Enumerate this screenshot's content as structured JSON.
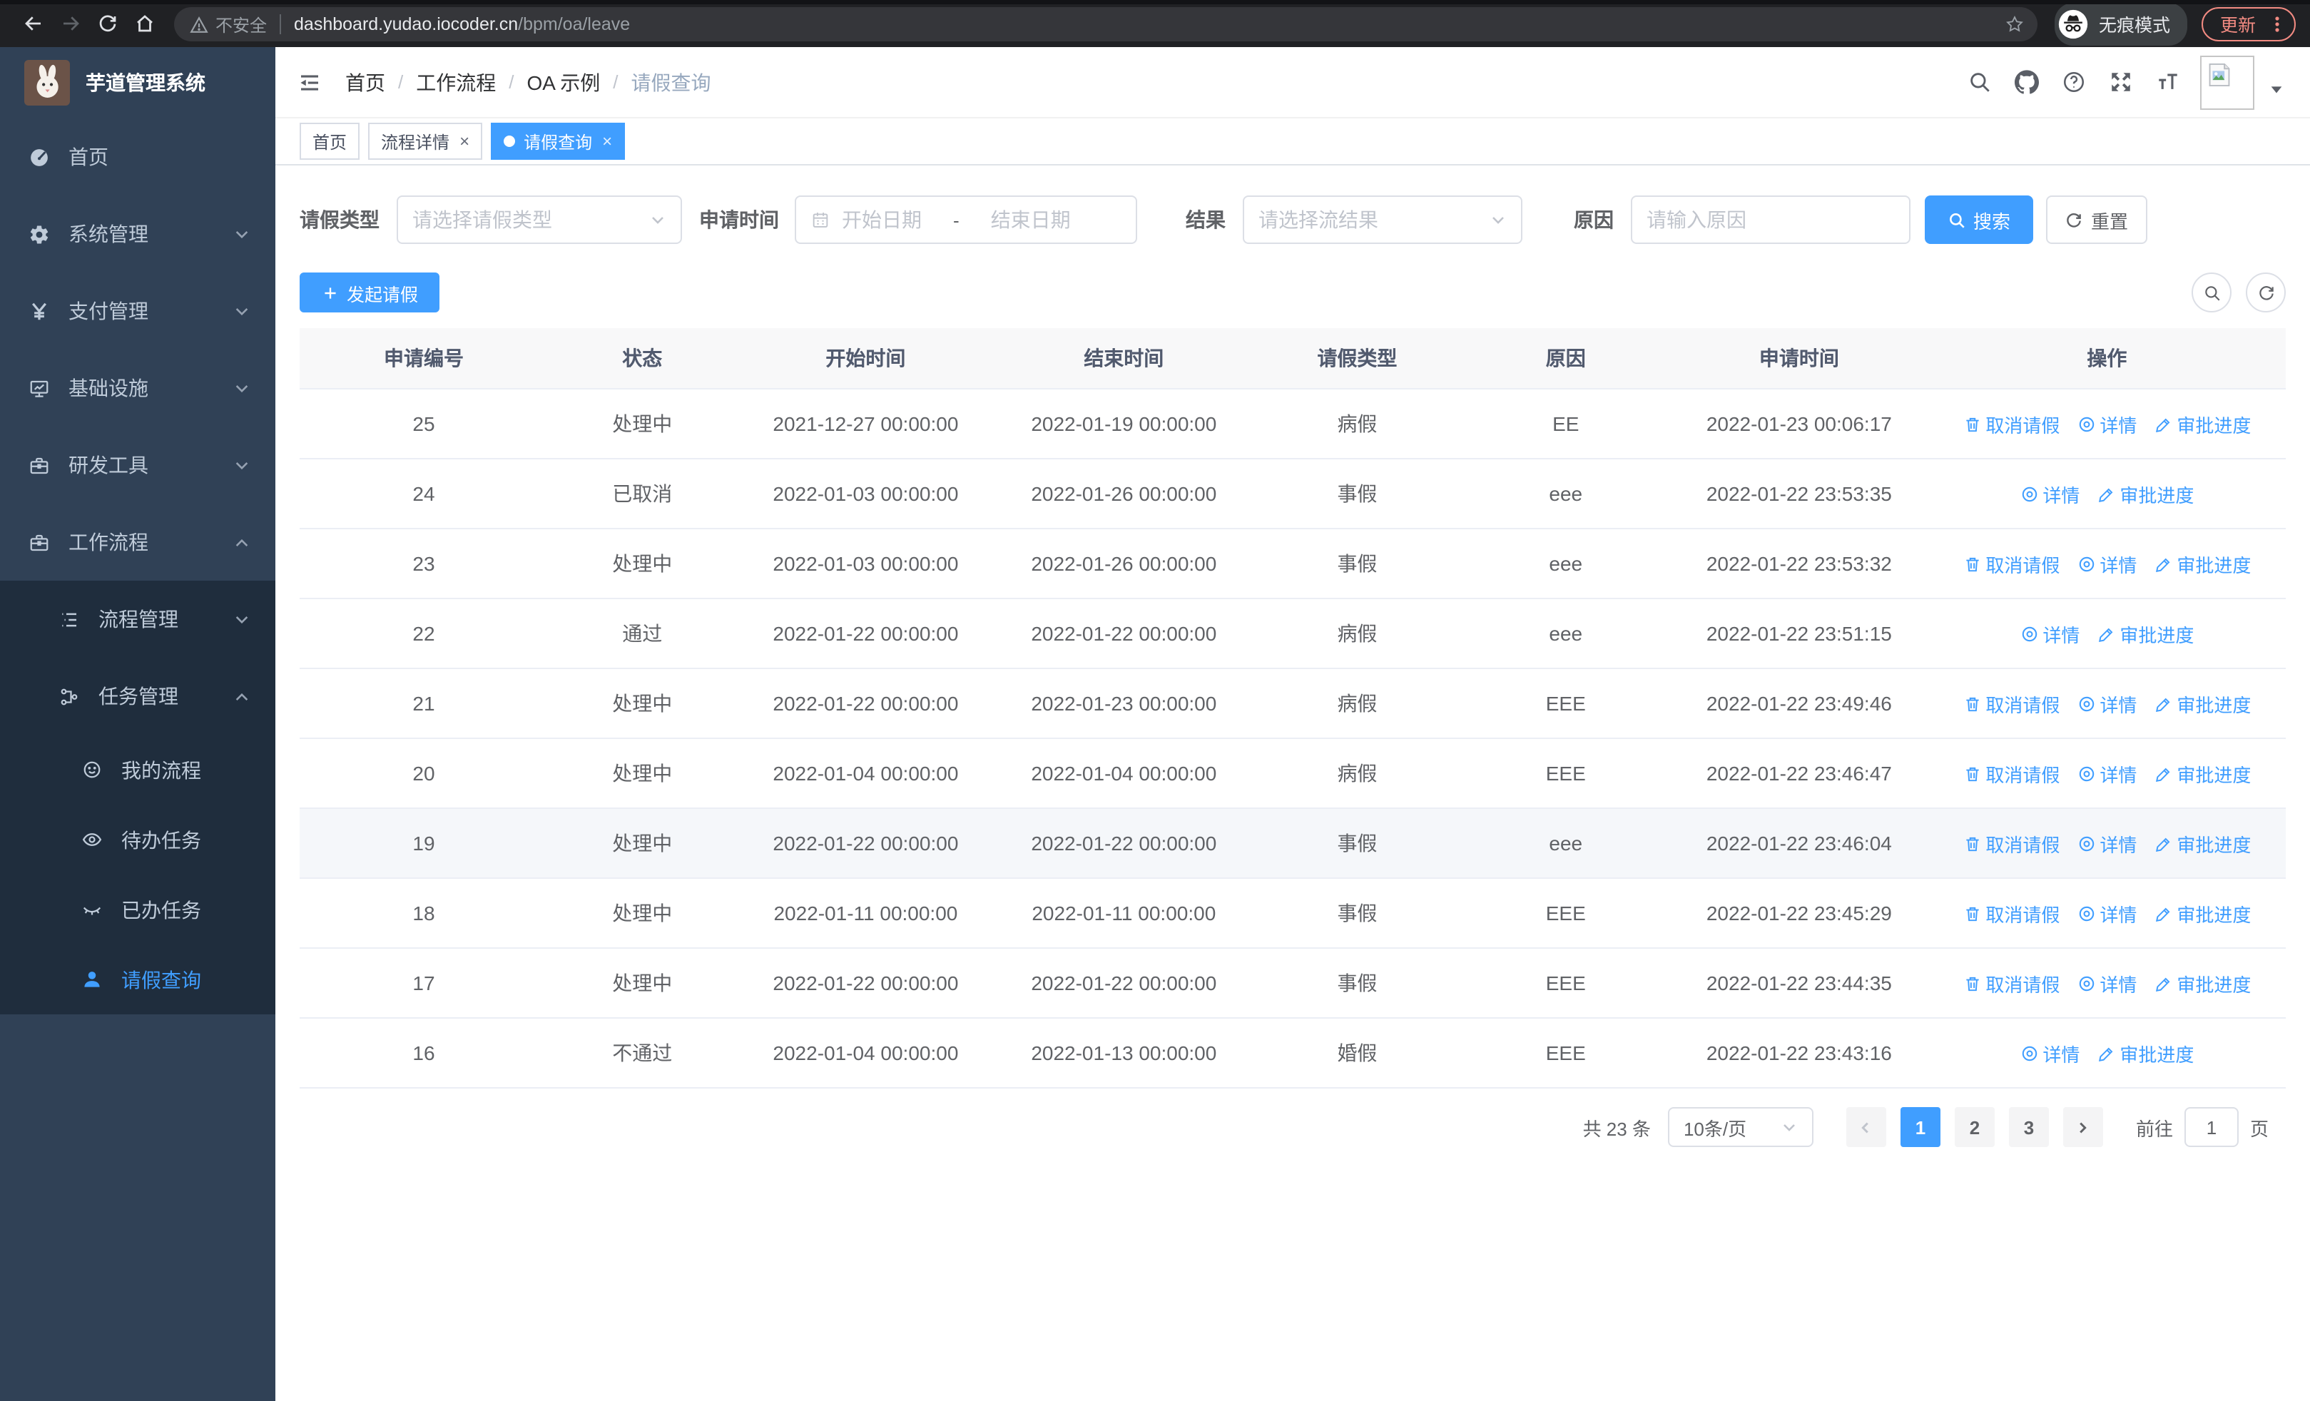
{
  "browser": {
    "security_label": "不安全",
    "url_host": "dashboard.yudao.iocoder.cn",
    "url_path": "/bpm/oa/leave",
    "incognito_label": "无痕模式",
    "update_label": "更新"
  },
  "sidebar": {
    "app_title": "芋道管理系统",
    "items": [
      {
        "label": "首页",
        "icon": "dashboard-icon",
        "level": 1
      },
      {
        "label": "系统管理",
        "icon": "gear-icon",
        "level": 1,
        "chevron": "down"
      },
      {
        "label": "支付管理",
        "icon": "yen-icon",
        "level": 1,
        "chevron": "down"
      },
      {
        "label": "基础设施",
        "icon": "monitor-icon",
        "level": 1,
        "chevron": "down"
      },
      {
        "label": "研发工具",
        "icon": "toolbox-icon",
        "level": 1,
        "chevron": "down"
      },
      {
        "label": "工作流程",
        "icon": "briefcase-icon",
        "level": 1,
        "chevron": "up"
      },
      {
        "label": "流程管理",
        "icon": "list-icon",
        "level": 2,
        "chevron": "down",
        "dark": true
      },
      {
        "label": "任务管理",
        "icon": "tree-icon",
        "level": 2,
        "chevron": "up",
        "dark": true
      },
      {
        "label": "我的流程",
        "icon": "face-icon",
        "level": 3,
        "dark": true
      },
      {
        "label": "待办任务",
        "icon": "eye-icon",
        "level": 3,
        "dark": true
      },
      {
        "label": "已办任务",
        "icon": "eye-closed-icon",
        "level": 3,
        "dark": true
      },
      {
        "label": "请假查询",
        "icon": "user-icon",
        "level": 3,
        "dark": true,
        "active": true
      }
    ]
  },
  "breadcrumb": {
    "items": [
      "首页",
      "工作流程",
      "OA 示例",
      "请假查询"
    ]
  },
  "tabs": [
    {
      "label": "首页",
      "closable": false,
      "active": false
    },
    {
      "label": "流程详情",
      "closable": true,
      "active": false
    },
    {
      "label": "请假查询",
      "closable": true,
      "active": true
    }
  ],
  "filters": {
    "leave_type_label": "请假类型",
    "leave_type_placeholder": "请选择请假类型",
    "apply_time_label": "申请时间",
    "start_placeholder": "开始日期",
    "range_separator": "-",
    "end_placeholder": "结束日期",
    "result_label": "结果",
    "result_placeholder": "请选择流结果",
    "reason_label": "原因",
    "reason_placeholder": "请输入原因",
    "search_label": "搜索",
    "reset_label": "重置"
  },
  "toolbar": {
    "create_label": "发起请假"
  },
  "table": {
    "columns": [
      "申请编号",
      "状态",
      "开始时间",
      "结束时间",
      "请假类型",
      "原因",
      "申请时间",
      "操作"
    ],
    "action_labels": {
      "cancel": "取消请假",
      "detail": "详情",
      "progress": "审批进度"
    },
    "rows": [
      {
        "id": "25",
        "status": "处理中",
        "start": "2021-12-27 00:00:00",
        "end": "2022-01-19 00:00:00",
        "type": "病假",
        "reason": "EE",
        "apply": "2022-01-23 00:06:17",
        "actions": [
          "cancel",
          "detail",
          "progress"
        ]
      },
      {
        "id": "24",
        "status": "已取消",
        "start": "2022-01-03 00:00:00",
        "end": "2022-01-26 00:00:00",
        "type": "事假",
        "reason": "eee",
        "apply": "2022-01-22 23:53:35",
        "actions": [
          "detail",
          "progress"
        ]
      },
      {
        "id": "23",
        "status": "处理中",
        "start": "2022-01-03 00:00:00",
        "end": "2022-01-26 00:00:00",
        "type": "事假",
        "reason": "eee",
        "apply": "2022-01-22 23:53:32",
        "actions": [
          "cancel",
          "detail",
          "progress"
        ]
      },
      {
        "id": "22",
        "status": "通过",
        "start": "2022-01-22 00:00:00",
        "end": "2022-01-22 00:00:00",
        "type": "病假",
        "reason": "eee",
        "apply": "2022-01-22 23:51:15",
        "actions": [
          "detail",
          "progress"
        ]
      },
      {
        "id": "21",
        "status": "处理中",
        "start": "2022-01-22 00:00:00",
        "end": "2022-01-23 00:00:00",
        "type": "病假",
        "reason": "EEE",
        "apply": "2022-01-22 23:49:46",
        "actions": [
          "cancel",
          "detail",
          "progress"
        ]
      },
      {
        "id": "20",
        "status": "处理中",
        "start": "2022-01-04 00:00:00",
        "end": "2022-01-04 00:00:00",
        "type": "病假",
        "reason": "EEE",
        "apply": "2022-01-22 23:46:47",
        "actions": [
          "cancel",
          "detail",
          "progress"
        ]
      },
      {
        "id": "19",
        "status": "处理中",
        "start": "2022-01-22 00:00:00",
        "end": "2022-01-22 00:00:00",
        "type": "事假",
        "reason": "eee",
        "apply": "2022-01-22 23:46:04",
        "actions": [
          "cancel",
          "detail",
          "progress"
        ],
        "highlight": true
      },
      {
        "id": "18",
        "status": "处理中",
        "start": "2022-01-11 00:00:00",
        "end": "2022-01-11 00:00:00",
        "type": "事假",
        "reason": "EEE",
        "apply": "2022-01-22 23:45:29",
        "actions": [
          "cancel",
          "detail",
          "progress"
        ]
      },
      {
        "id": "17",
        "status": "处理中",
        "start": "2022-01-22 00:00:00",
        "end": "2022-01-22 00:00:00",
        "type": "事假",
        "reason": "EEE",
        "apply": "2022-01-22 23:44:35",
        "actions": [
          "cancel",
          "detail",
          "progress"
        ]
      },
      {
        "id": "16",
        "status": "不通过",
        "start": "2022-01-04 00:00:00",
        "end": "2022-01-13 00:00:00",
        "type": "婚假",
        "reason": "EEE",
        "apply": "2022-01-22 23:43:16",
        "actions": [
          "detail",
          "progress"
        ]
      }
    ]
  },
  "pagination": {
    "total_label": "共 23 条",
    "page_size_label": "10条/页",
    "pages": [
      "1",
      "2",
      "3"
    ],
    "active_page": "1",
    "goto_label": "前往",
    "goto_value": "1",
    "page_unit": "页"
  },
  "colors": {
    "primary": "#409eff",
    "sidebar_bg": "#304156",
    "submenu_bg": "#1f2d3d",
    "update_accent": "#f28b82"
  }
}
